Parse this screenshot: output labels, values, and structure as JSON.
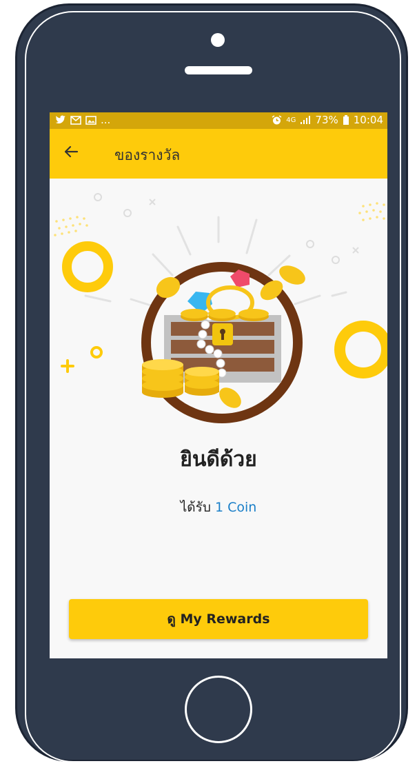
{
  "status_bar": {
    "left_icons": [
      "twitter-icon",
      "gmail-icon",
      "image-icon"
    ],
    "left_more": "...",
    "network": "4G",
    "battery": "73%",
    "time": "10:04"
  },
  "app_bar": {
    "back_icon": "arrow-left-icon",
    "title": "ของรางวัล"
  },
  "content": {
    "congrats": "ยินดีด้วย",
    "received_prefix": "ได้รับ",
    "received_amount": "1 Coin"
  },
  "action": {
    "button_label": "ดู My Rewards"
  },
  "colors": {
    "accent": "#fecb0b",
    "status_bar": "#d4a60a",
    "phone_body": "#2f3a4c",
    "coin_text": "#1a7fc8"
  }
}
